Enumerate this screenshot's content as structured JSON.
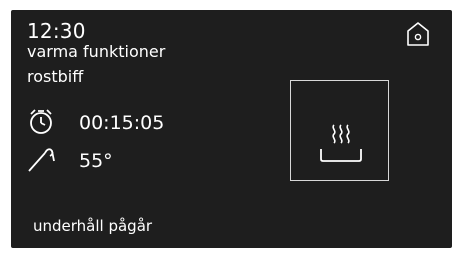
{
  "header": {
    "time": "12:30",
    "mode": "varma funktioner",
    "program": "rostbiff"
  },
  "timer": {
    "icon": "stopwatch-icon",
    "value": "00:15:05"
  },
  "probe": {
    "icon": "meat-probe-icon",
    "value": "55°"
  },
  "status": {
    "text": "underhåll pågår"
  },
  "controls": {
    "home_icon": "home-icon",
    "function_icon": "warming-plate-icon"
  },
  "colors": {
    "screen_background": "#1e1e1e",
    "foreground": "#ffffff",
    "tile_border": "#d8d8d8"
  }
}
